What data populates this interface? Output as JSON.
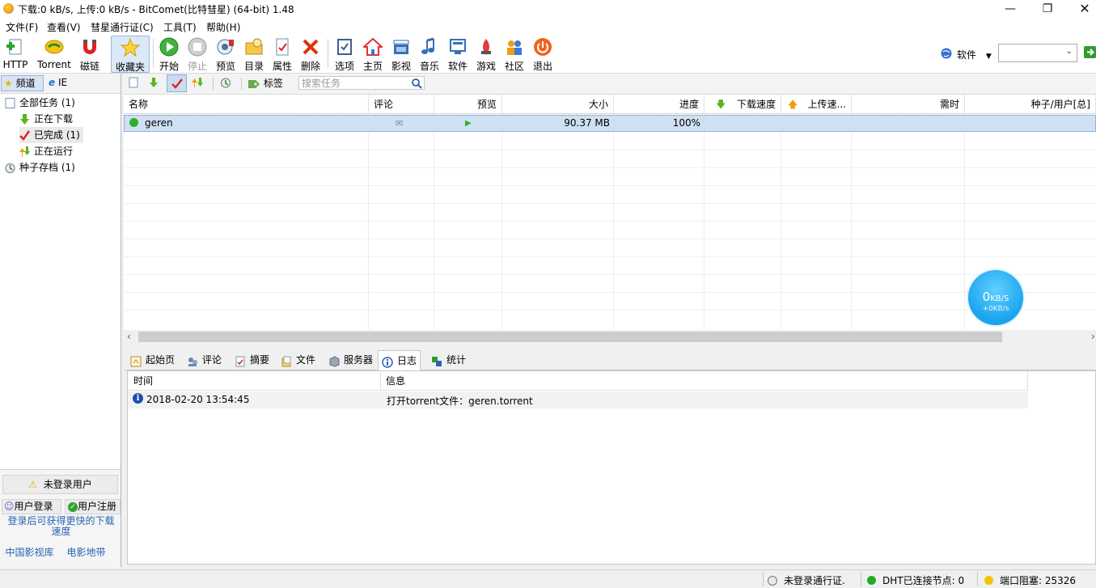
{
  "window": {
    "title": "下载:0 kB/s, 上传:0 kB/s - BitComet(比特彗星) (64-bit) 1.48"
  },
  "menu": [
    "文件(F)",
    "查看(V)",
    "彗星通行证(C)",
    "工具(T)",
    "帮助(H)"
  ],
  "toolbar": {
    "http": "HTTP",
    "torrent": "Torrent",
    "magnet": "磁链",
    "favorites": "收藏夹",
    "start": "开始",
    "stop": "停止",
    "preview": "预览",
    "directory": "目录",
    "properties": "属性",
    "delete": "删除",
    "options": "选项",
    "home": "主页",
    "video": "影视",
    "music": "音乐",
    "software": "软件",
    "games": "游戏",
    "community": "社区",
    "exit": "退出",
    "search_category": "软件"
  },
  "left_panel": {
    "tabs": [
      "频道",
      "IE"
    ],
    "tree": {
      "all_tasks": "全部任务 (1)",
      "downloading": "正在下载",
      "completed": "已完成 (1)",
      "running": "正在运行",
      "torrent_archive": "种子存档 (1)"
    },
    "user": {
      "not_logged_in": "未登录用户",
      "login": "用户登录",
      "register": "用户注册",
      "tip": "登录后可获得更快的下载速度"
    },
    "links": [
      "中国影视库",
      "电影地带"
    ]
  },
  "task_toolbar": {
    "tag_label": "标签",
    "search_placeholder": "搜索任务"
  },
  "task_table": {
    "columns": [
      "名称",
      "评论",
      "预览",
      "大小",
      "进度",
      "下载速度",
      "上传速...",
      "需时",
      "种子/用户[总]"
    ],
    "rows": [
      {
        "name": "geren",
        "size": "90.37 MB",
        "progress": "100%"
      }
    ]
  },
  "speed_bubble": {
    "value": "0",
    "unit": "KB/S",
    "upload": "+0KB/s"
  },
  "bottom_tabs": [
    "起始页",
    "评论",
    "摘要",
    "文件",
    "服务器",
    "日志",
    "统计"
  ],
  "log": {
    "columns": [
      "时间",
      "信息"
    ],
    "rows": [
      {
        "time": "2018-02-20 13:54:45",
        "message": "打开torrent文件：geren.torrent"
      }
    ]
  },
  "status_bar": {
    "passport": "未登录通行证.",
    "dht": "DHT已连接节点: 0",
    "port": "端口阻塞: 25326"
  }
}
